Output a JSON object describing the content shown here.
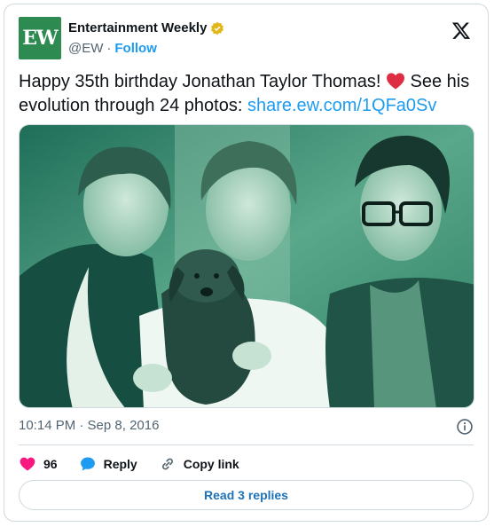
{
  "account": {
    "logo_text": "EW",
    "name": "Entertainment Weekly",
    "handle": "@EW",
    "separator": "·",
    "follow_label": "Follow"
  },
  "tweet": {
    "text_part1": "Happy 35th birthday Jonathan Taylor Thomas! ",
    "text_part2": " See his evolution through 24 photos: ",
    "link_text": "share.ew.com/1QFa0Sv",
    "timestamp": "10:14 PM · Sep 8, 2016"
  },
  "actions": {
    "likes_count": "96",
    "reply_label": "Reply",
    "copy_link_label": "Copy link"
  },
  "footer": {
    "read_replies_label": "Read 3 replies"
  },
  "colors": {
    "accent": "#1d9bf0",
    "brand_green": "#2d8a50",
    "like_pink": "#f91880",
    "photo_tint": "#2f8f72"
  }
}
